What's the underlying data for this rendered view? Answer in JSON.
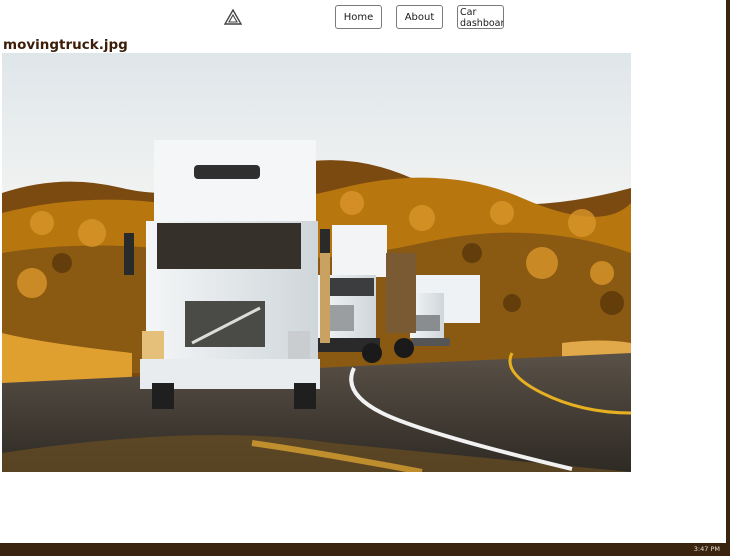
{
  "nav": {
    "home_label": "Home",
    "about_label": "About",
    "car_dashboard_label": "Car dashboard"
  },
  "file": {
    "name": "movingtruck.jpg"
  },
  "taskbar": {
    "clock": "3:47 PM"
  },
  "icons": {
    "logo": "triangle-logo-icon"
  },
  "colors": {
    "title_text": "#3b1d08",
    "taskbar_bg": "#3a2410"
  }
}
